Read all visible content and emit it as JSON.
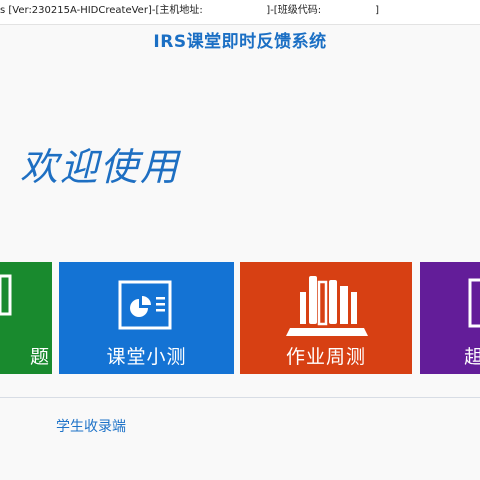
{
  "window": {
    "title": "s [Ver:230215A-HIDCreateVer]-[主机地址:                    ]-[班级代码:                 ]"
  },
  "app": {
    "title": "IRS课堂即时反馈系统",
    "welcome": "欢迎使用"
  },
  "tiles": [
    {
      "label": "题",
      "color": "#198a2e",
      "icon": "partial-icon"
    },
    {
      "label": "课堂小测",
      "color": "#1473d4",
      "icon": "quiz-chart-icon"
    },
    {
      "label": "作业周测",
      "color": "#d74013",
      "icon": "books-icon"
    },
    {
      "label": "趄",
      "color": "#631d99",
      "icon": "partial-icon"
    }
  ],
  "footer": {
    "link": "学生收录端"
  }
}
